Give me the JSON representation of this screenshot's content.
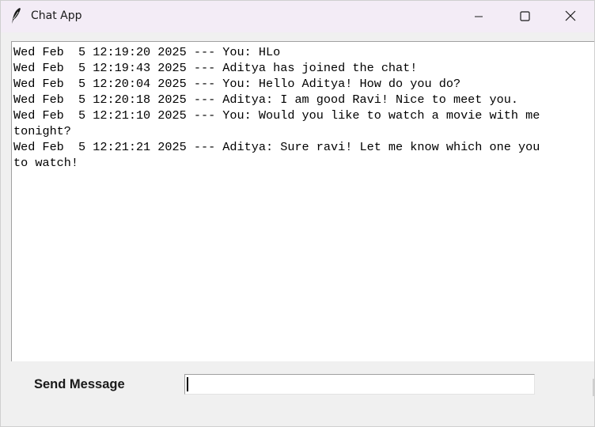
{
  "window": {
    "title": "Chat App"
  },
  "titlebar": {
    "app_icon": "feather-icon",
    "minimize_icon": "minimize-icon",
    "maximize_icon": "maximize-icon",
    "close_icon": "close-icon"
  },
  "chat": {
    "lines": [
      "Wed Feb  5 12:19:20 2025 --- You: HLo",
      "Wed Feb  5 12:19:43 2025 --- Aditya has joined the chat!",
      "Wed Feb  5 12:20:04 2025 --- You: Hello Aditya! How do you do?",
      "Wed Feb  5 12:20:18 2025 --- Aditya: I am good Ravi! Nice to meet you.",
      "Wed Feb  5 12:21:10 2025 --- You: Would you like to watch a movie with me",
      "tonight?",
      "Wed Feb  5 12:21:21 2025 --- Aditya: Sure ravi! Let me know which one you",
      "to watch!"
    ]
  },
  "composer": {
    "label": "Send Message",
    "input_value": ""
  },
  "colors": {
    "titlebar_bg": "#f3ecf6",
    "window_bg": "#f0f0f0",
    "chat_bg": "#ffffff"
  }
}
